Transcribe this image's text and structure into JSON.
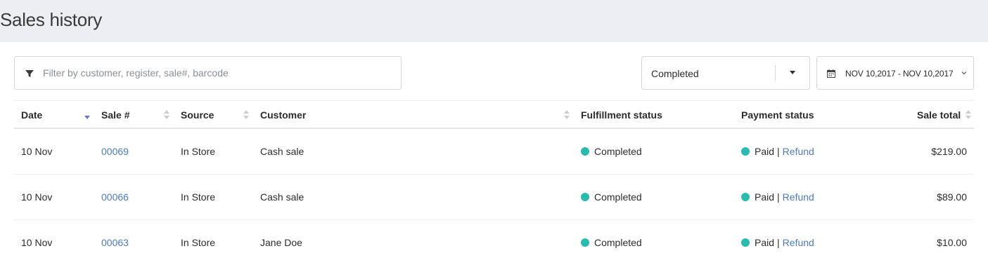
{
  "header": {
    "title": "Sales history"
  },
  "filter": {
    "placeholder": "Filter by customer, register, sale#, barcode",
    "value": ""
  },
  "status_filter": {
    "selected": "Completed"
  },
  "date_range": {
    "label": "NOV 10,2017 - NOV 10,2017"
  },
  "table": {
    "columns": {
      "date": "Date",
      "sale": "Sale #",
      "source": "Source",
      "customer": "Customer",
      "fulfillment": "Fulfillment status",
      "payment": "Payment status",
      "total": "Sale total"
    },
    "rows": [
      {
        "date": "10 Nov",
        "sale": "00069",
        "source": "In Store",
        "customer": "Cash sale",
        "fulfillment": "Completed",
        "payment": "Paid",
        "action": "Refund",
        "total": "$219.00"
      },
      {
        "date": "10 Nov",
        "sale": "00066",
        "source": "In Store",
        "customer": "Cash sale",
        "fulfillment": "Completed",
        "payment": "Paid",
        "action": "Refund",
        "total": "$89.00"
      },
      {
        "date": "10 Nov",
        "sale": "00063",
        "source": "In Store",
        "customer": "Jane Doe",
        "fulfillment": "Completed",
        "payment": "Paid",
        "action": "Refund",
        "total": "$10.00"
      }
    ]
  },
  "colors": {
    "status_dot": "#2bbbad",
    "link": "#4f7ab3",
    "header_bg": "#eceef3",
    "active_sort": "#6b74c9",
    "inactive_sort": "#c9ccd1"
  },
  "icons": {
    "filter": "filter-icon",
    "calendar": "calendar-icon",
    "chevron": "chevron-down-icon",
    "caret": "caret-down-icon",
    "sort": "sort-icon"
  }
}
